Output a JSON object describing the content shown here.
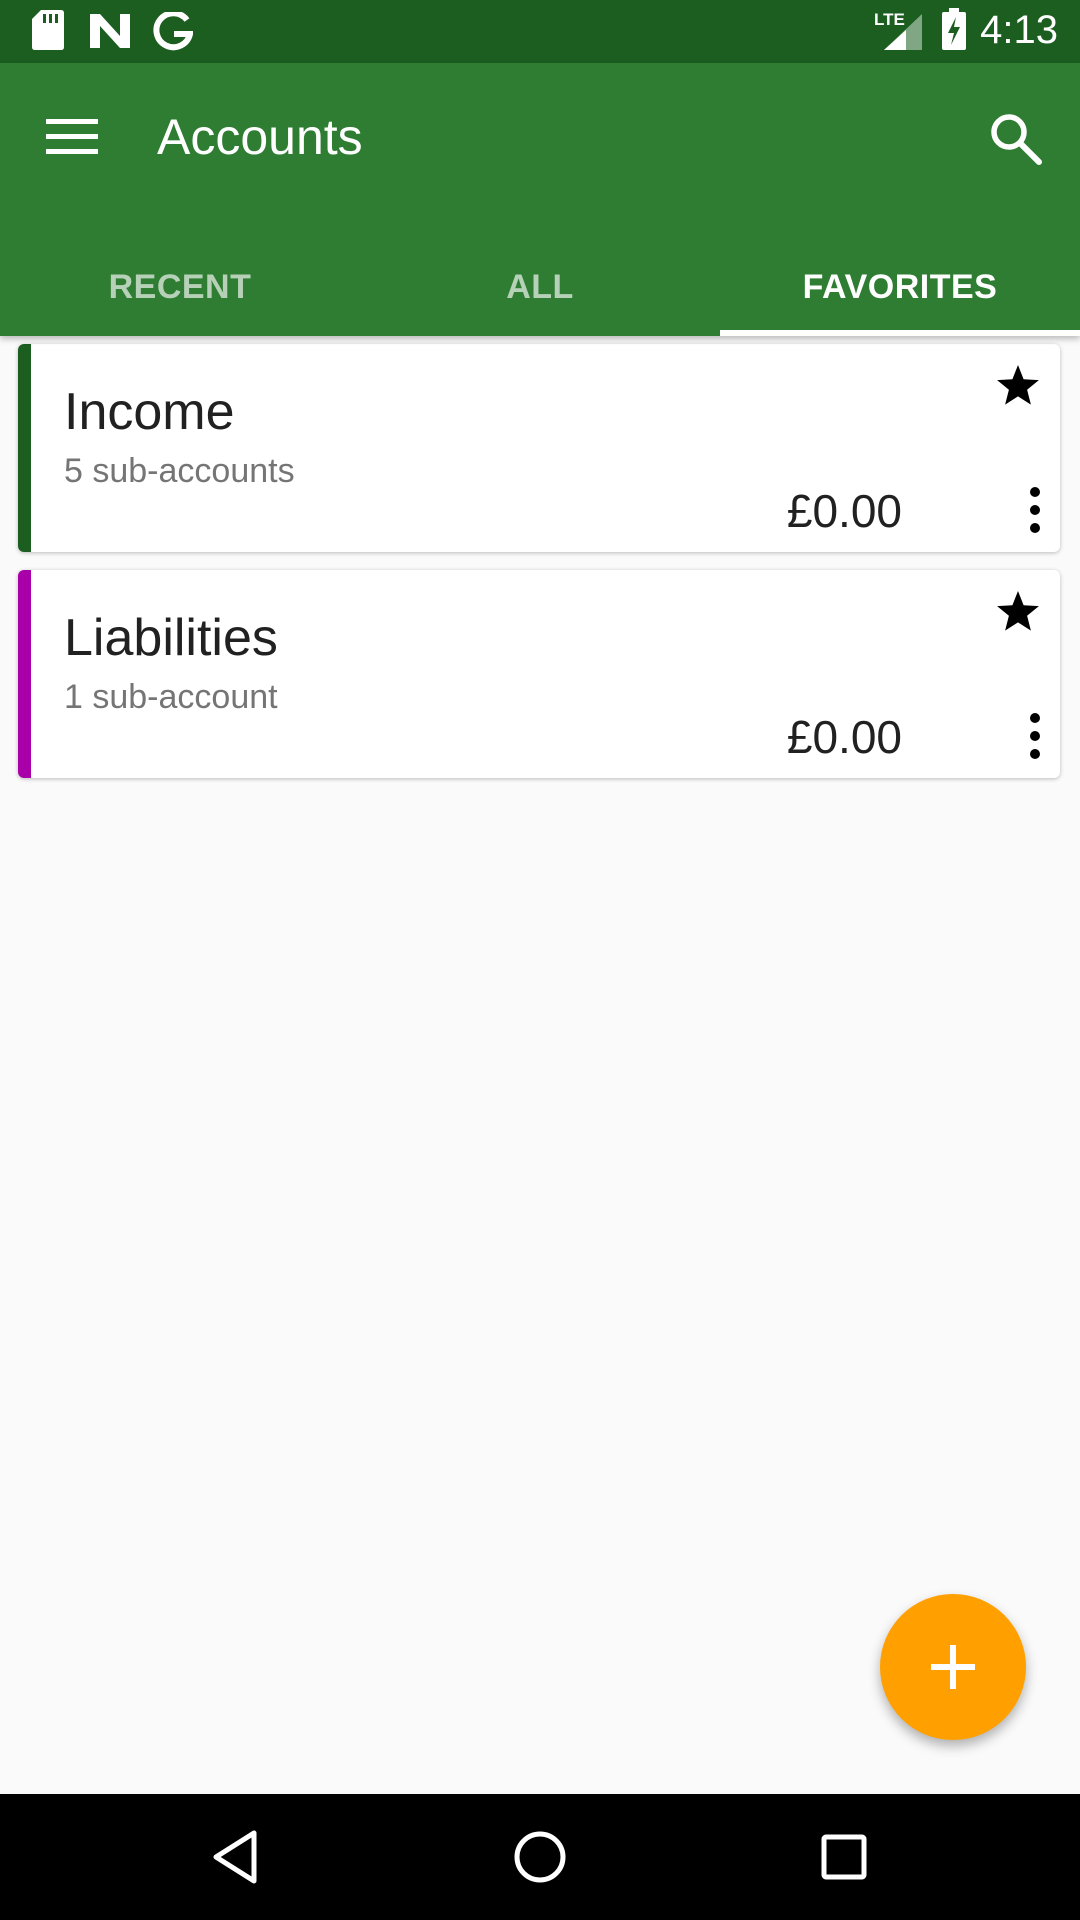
{
  "status_bar": {
    "time": "4:13",
    "network_label": "LTE",
    "icons": [
      "sd-card-icon",
      "n-notification-icon",
      "google-g-icon",
      "lte-signal-icon",
      "battery-charging-icon"
    ]
  },
  "app_bar": {
    "title": "Accounts",
    "menu_icon": "hamburger-menu-icon",
    "search_icon": "search-icon",
    "color": "#2e7d32"
  },
  "tabs": [
    {
      "label": "RECENT",
      "active": false
    },
    {
      "label": "ALL",
      "active": false
    },
    {
      "label": "FAVORITES",
      "active": true
    }
  ],
  "accounts": [
    {
      "name": "Income",
      "subaccounts": "5 sub-accounts",
      "balance": "£0.00",
      "color": "#1b5e20",
      "favorite": true
    },
    {
      "name": "Liabilities",
      "subaccounts": "1 sub-account",
      "balance": "£0.00",
      "color": "#aa00aa",
      "favorite": true
    }
  ],
  "fab": {
    "icon": "plus-icon",
    "color": "#ffa000"
  },
  "nav_bar": {
    "icons": [
      "back-icon",
      "home-icon",
      "recents-icon"
    ]
  }
}
